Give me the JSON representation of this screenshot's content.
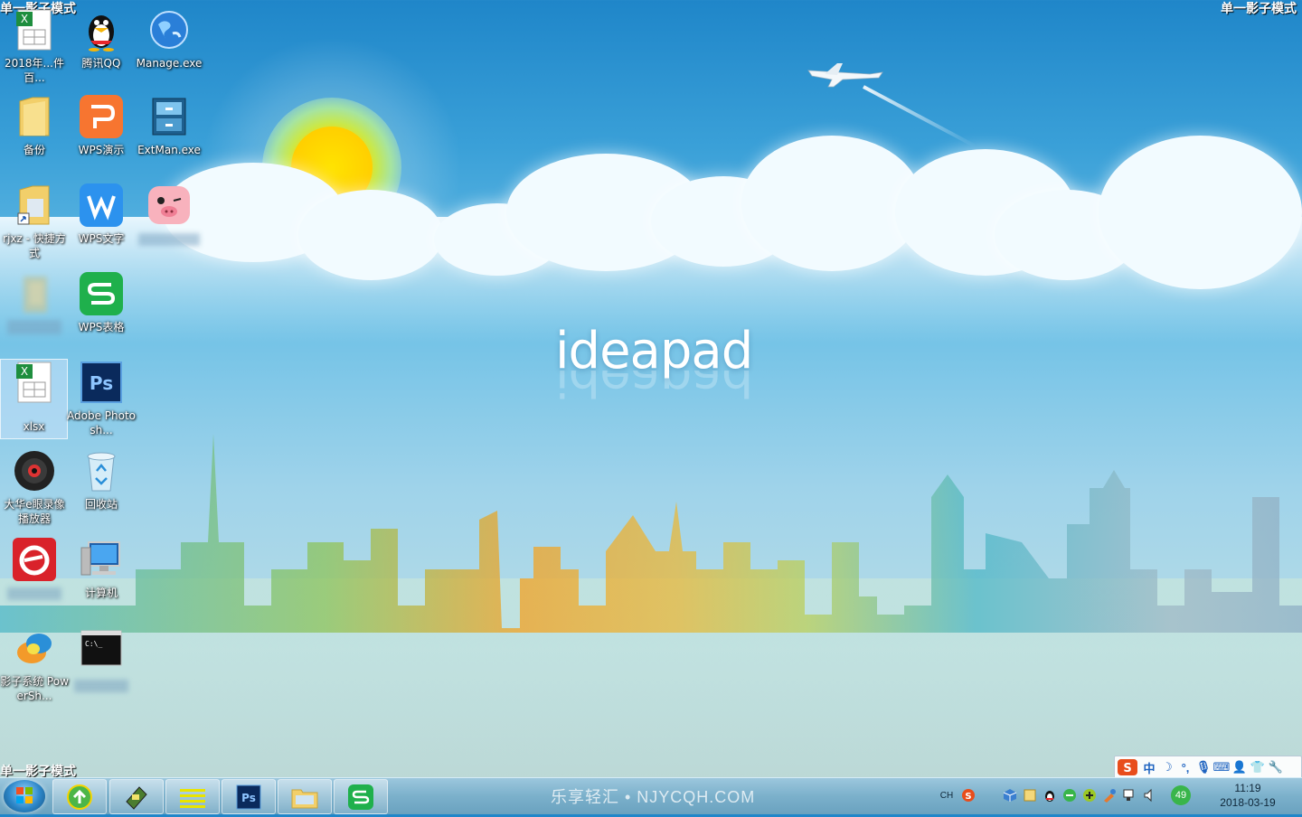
{
  "mode_label_topleft": "单一影子模式",
  "mode_label_topright": "单一影子模式",
  "mode_label_bottomleft": "单一影子模式",
  "wallpaper": {
    "brand": "ideapad"
  },
  "desktop_icons": [
    {
      "label": "2018年...件百...",
      "icon": "excel-file-icon"
    },
    {
      "label": "腾讯QQ",
      "icon": "qq-penguin-icon"
    },
    {
      "label": "Manage.exe",
      "icon": "globe-icon"
    },
    {
      "label": "备份",
      "icon": "folder-icon"
    },
    {
      "label": "WPS演示",
      "icon": "wps-presentation-icon"
    },
    {
      "label": "ExtMan.exe",
      "icon": "cabinet-icon"
    },
    {
      "label": "rjxz - 快捷方式",
      "icon": "folder-shortcut-icon"
    },
    {
      "label": "WPS文字",
      "icon": "wps-writer-icon"
    },
    {
      "label": "",
      "icon": "pig-icon"
    },
    {
      "label": "",
      "icon": "blurred-app-icon"
    },
    {
      "label": "WPS表格",
      "icon": "wps-spreadsheet-icon"
    },
    {
      "label": "xlsx",
      "icon": "excel-file-icon"
    },
    {
      "label": "Adobe Photosh...",
      "icon": "photoshop-icon"
    },
    {
      "label": "大华e眼录像播放器",
      "icon": "disc-player-icon"
    },
    {
      "label": "回收站",
      "icon": "recycle-bin-icon"
    },
    {
      "label": "",
      "icon": "red-e-icon"
    },
    {
      "label": "计算机",
      "icon": "computer-icon"
    },
    {
      "label": "影子系统 PowerSh...",
      "icon": "shadow-system-icon"
    },
    {
      "label": "",
      "icon": "cmd-icon"
    }
  ],
  "taskbar": {
    "watermark": "乐享轻汇 • NJYCQH.COM",
    "apps": [
      "360-browser",
      "flash-tool",
      "notepad",
      "photoshop",
      "explorer",
      "wps-spreadsheet"
    ],
    "lang": "CH",
    "badge": "49",
    "time": "11:19",
    "date": "2018-03-19"
  },
  "ime": {
    "mode_char": "中"
  }
}
